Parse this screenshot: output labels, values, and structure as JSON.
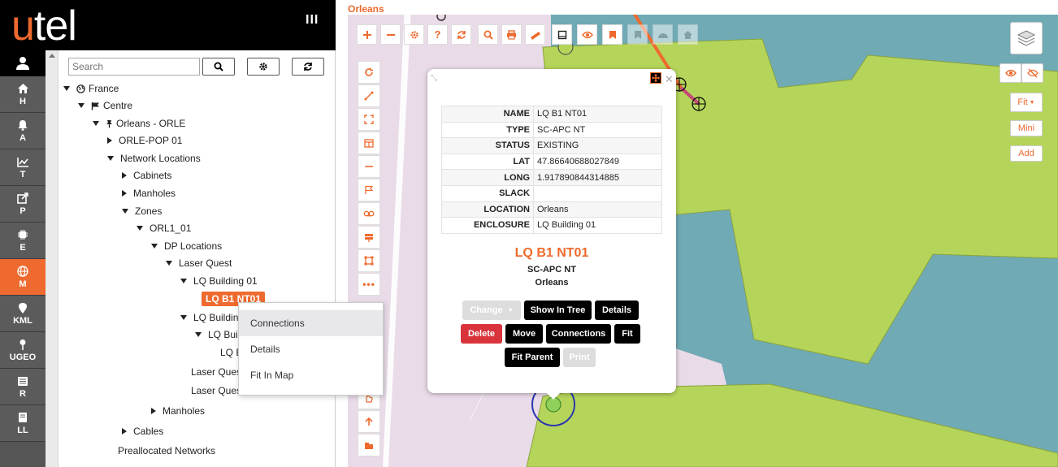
{
  "app": {
    "logo_u": "u",
    "logo_rest": "tel"
  },
  "nav": {
    "items": [
      {
        "id": "H",
        "label": "H",
        "icon": "home-icon"
      },
      {
        "id": "A",
        "label": "A",
        "icon": "bell-icon"
      },
      {
        "id": "T",
        "label": "T",
        "icon": "chart-icon"
      },
      {
        "id": "P",
        "label": "P",
        "icon": "share-icon"
      },
      {
        "id": "E",
        "label": "E",
        "icon": "chip-icon"
      },
      {
        "id": "M",
        "label": "M",
        "icon": "globe-icon",
        "active": true
      },
      {
        "id": "KML",
        "label": "KML",
        "icon": "map-pin-icon"
      },
      {
        "id": "UGEO",
        "label": "UGEO",
        "icon": "pushpin-icon"
      },
      {
        "id": "R",
        "label": "R",
        "icon": "list-icon"
      },
      {
        "id": "LL",
        "label": "LL",
        "icon": "book-icon"
      }
    ]
  },
  "search": {
    "placeholder": "Search"
  },
  "tree": {
    "france": "France",
    "centre": "Centre",
    "orleans": "Orleans - ORLE",
    "orle_pop": "ORLE-POP 01",
    "network_locations": "Network Locations",
    "cabinets": "Cabinets",
    "manholes": "Manholes",
    "zones": "Zones",
    "orl1": "ORL1_01",
    "dp_locations": "DP Locations",
    "laser_quest": "Laser Quest",
    "lq_building_01": "LQ Building 01",
    "lq_b1_nt01": "LQ B1 NT01",
    "lq_building_2": "LQ Building",
    "lq_build_3": "LQ Build",
    "lq_b_4": "LQ B",
    "laser_quest_a": "Laser Quest",
    "laser_quest_b": "Laser Quest",
    "manholes_2": "Manholes",
    "cables": "Cables",
    "preallocated": "Preallocated Networks"
  },
  "context_menu": {
    "items": [
      "Connections",
      "Details",
      "Fit In Map"
    ]
  },
  "map": {
    "title": "Orleans",
    "right_buttons": {
      "fit": "Fit",
      "mini": "Mini",
      "add": "Add"
    },
    "colors": {
      "background": "#e9dbe8",
      "teal": "#6faab5",
      "green": "#b5d55a",
      "cable": "#ee6a2e"
    }
  },
  "popup": {
    "properties": [
      {
        "key": "NAME",
        "value": "LQ B1 NT01"
      },
      {
        "key": "TYPE",
        "value": "SC-APC NT"
      },
      {
        "key": "STATUS",
        "value": "EXISTING"
      },
      {
        "key": "LAT",
        "value": "47.86640688027849"
      },
      {
        "key": "LONG",
        "value": "1.917890844314885"
      },
      {
        "key": "SLACK",
        "value": ""
      },
      {
        "key": "LOCATION",
        "value": "Orleans"
      },
      {
        "key": "ENCLOSURE",
        "value": "LQ Building 01"
      }
    ],
    "name": "LQ B1 NT01",
    "type": "SC-APC NT",
    "location": "Orleans",
    "buttons": {
      "change": "Change",
      "show_in_tree": "Show In Tree",
      "details": "Details",
      "delete": "Delete",
      "move": "Move",
      "connections": "Connections",
      "fit": "Fit",
      "fit_parent": "Fit Parent",
      "print": "Print"
    }
  }
}
